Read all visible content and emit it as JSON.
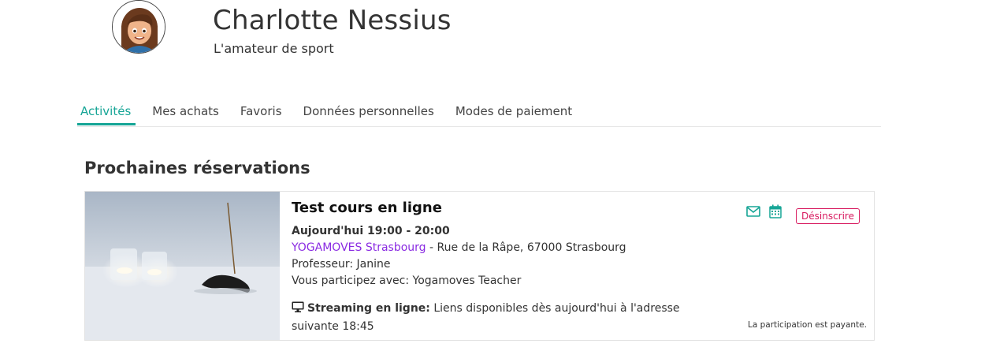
{
  "profile": {
    "name": "Charlotte Nessius",
    "subtitle": "L'amateur de sport"
  },
  "tabs": [
    {
      "label": "Activités",
      "active": true
    },
    {
      "label": "Mes achats",
      "active": false
    },
    {
      "label": "Favoris",
      "active": false
    },
    {
      "label": "Données personnelles",
      "active": false
    },
    {
      "label": "Modes de paiement",
      "active": false
    }
  ],
  "section": {
    "title": "Prochaines réservations"
  },
  "booking": {
    "title": "Test cours en ligne",
    "time": "Aujourd'hui 19:00 - 20:00",
    "studio": "YOGAMOVES Strasbourg",
    "address": " - Rue de la Râpe, 67000 Strasbourg",
    "teacher": "Professeur: Janine",
    "participants": "Vous participez avec: Yogamoves Teacher",
    "streaming_label": "Streaming en ligne:",
    "streaming_text": " Liens disponibles dès aujourd'hui à l'adresse suivante 18:45",
    "unsubscribe_label": "Désinscrire",
    "paid_note": "La participation est payante.",
    "icons": {
      "mail": "envelope-icon",
      "calendar": "calendar-icon",
      "streaming": "monitor-icon"
    }
  },
  "colors": {
    "accent": "#16a596",
    "link": "#8a2be2",
    "danger": "#d81b60"
  }
}
